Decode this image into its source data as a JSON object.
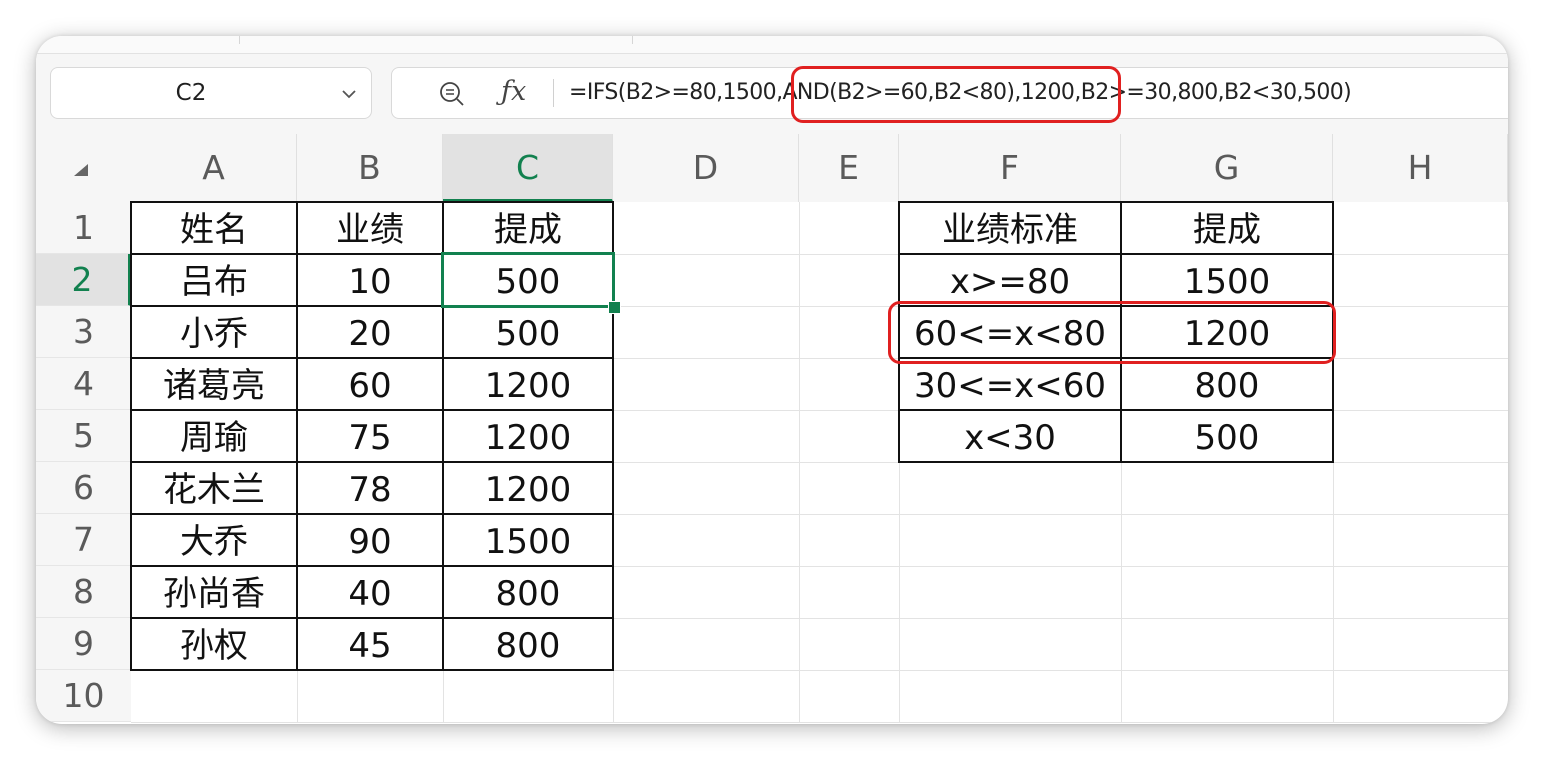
{
  "name_box": {
    "value": "C2"
  },
  "formula_bar": {
    "formula": "=IFS(B2>=80,1500,AND(B2>=60,B2<80),1200,B2>=30,800,B2<30,500)"
  },
  "column_headers": [
    "A",
    "B",
    "C",
    "D",
    "E",
    "F",
    "G",
    "H"
  ],
  "row_headers": [
    "1",
    "2",
    "3",
    "4",
    "5",
    "6",
    "7",
    "8",
    "9",
    "10"
  ],
  "main_table": {
    "headers": [
      "姓名",
      "业绩",
      "提成"
    ],
    "rows": [
      [
        "吕布",
        "10",
        "500"
      ],
      [
        "小乔",
        "20",
        "500"
      ],
      [
        "诸葛亮",
        "60",
        "1200"
      ],
      [
        "周瑜",
        "75",
        "1200"
      ],
      [
        "花木兰",
        "78",
        "1200"
      ],
      [
        "大乔",
        "90",
        "1500"
      ],
      [
        "孙尚香",
        "40",
        "800"
      ],
      [
        "孙权",
        "45",
        "800"
      ]
    ]
  },
  "criteria_table": {
    "headers": [
      "业绩标准",
      "提成"
    ],
    "rows": [
      [
        "x>=80",
        "1500"
      ],
      [
        "60<=x<80",
        "1200"
      ],
      [
        "30<=x<60",
        "800"
      ],
      [
        "x<30",
        "500"
      ]
    ]
  },
  "selection": {
    "cell": "C2",
    "column": "C",
    "row": "2"
  },
  "colors": {
    "accent": "#12814f",
    "highlight": "#e02020"
  }
}
